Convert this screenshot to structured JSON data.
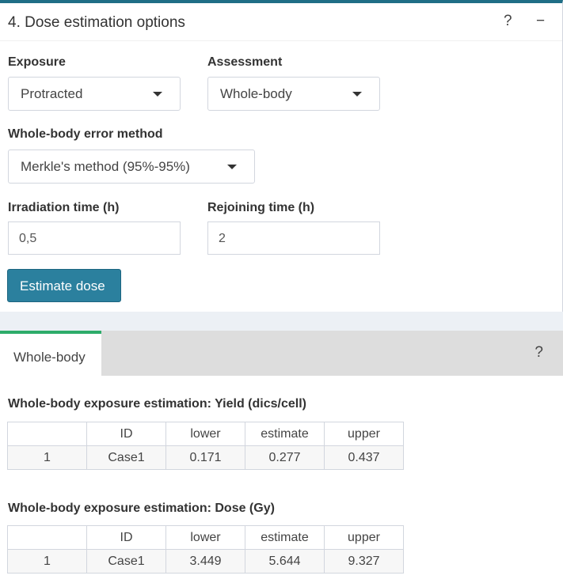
{
  "box": {
    "title": "4. Dose estimation options",
    "help_icon": "?",
    "collapse_icon": "−"
  },
  "exposure": {
    "label": "Exposure",
    "value": "Protracted"
  },
  "assessment": {
    "label": "Assessment",
    "value": "Whole-body"
  },
  "error_method": {
    "label": "Whole-body error method",
    "value": "Merkle's method (95%-95%)"
  },
  "irradiation": {
    "label": "Irradiation time (h)",
    "value": "0,5"
  },
  "rejoining": {
    "label": "Rejoining time (h)",
    "value": "2"
  },
  "estimate_button": "Estimate dose",
  "results": {
    "tab_label": "Whole-body",
    "help_icon": "?",
    "columns": [
      "",
      "ID",
      "lower",
      "estimate",
      "upper"
    ],
    "yield_table": {
      "title": "Whole-body exposure estimation: Yield (dics/cell)",
      "rows": [
        [
          "1",
          "Case1",
          "0.171",
          "0.277",
          "0.437"
        ]
      ]
    },
    "dose_table": {
      "title": "Whole-body exposure estimation: Dose (Gy)",
      "rows": [
        [
          "1",
          "Case1",
          "3.449",
          "5.644",
          "9.327"
        ]
      ]
    }
  }
}
